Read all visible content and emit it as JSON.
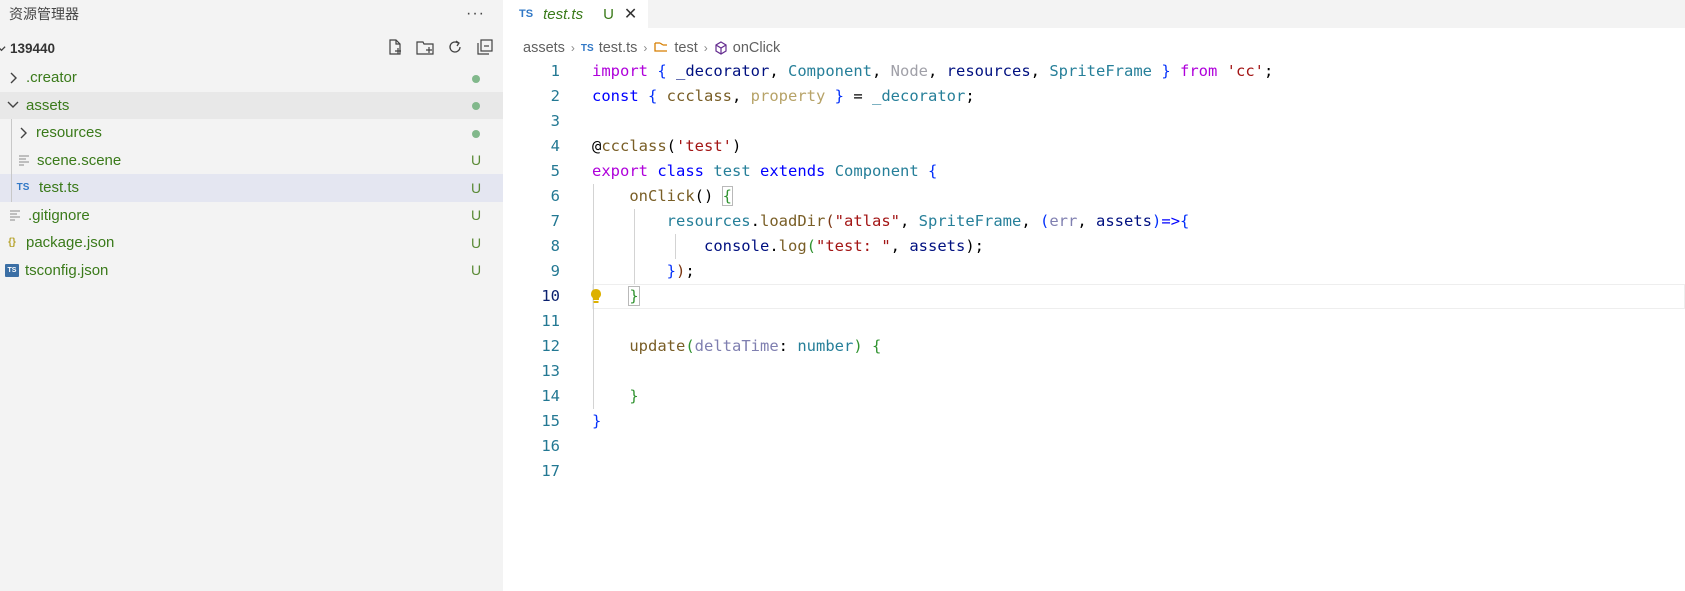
{
  "explorer": {
    "title": "资源管理器",
    "more": "···",
    "root": "139440",
    "items": [
      {
        "label": ".creator",
        "status": "dot",
        "kind": "folder"
      },
      {
        "label": "assets",
        "status": "dot",
        "kind": "folder-open"
      },
      {
        "label": "resources",
        "status": "dot",
        "kind": "folder"
      },
      {
        "label": "scene.scene",
        "status": "U",
        "kind": "file"
      },
      {
        "label": "test.ts",
        "status": "U",
        "kind": "ts",
        "icon_text": "TS"
      },
      {
        "label": ".gitignore",
        "status": "U",
        "kind": "file"
      },
      {
        "label": "package.json",
        "status": "U",
        "kind": "json",
        "icon_text": "{}"
      },
      {
        "label": "tsconfig.json",
        "status": "U",
        "kind": "tsconfig",
        "icon_text": "TS"
      }
    ]
  },
  "tab": {
    "icon_text": "TS",
    "name": "test.ts",
    "status": "U",
    "close": "✕"
  },
  "breadcrumb": [
    "assets",
    "test.ts",
    "test",
    "onClick"
  ],
  "breadcrumb_icon_ts": "TS",
  "line_numbers": [
    "1",
    "2",
    "3",
    "4",
    "5",
    "6",
    "7",
    "8",
    "9",
    "10",
    "11",
    "12",
    "13",
    "14",
    "15",
    "16",
    "17"
  ],
  "code": {
    "l1": [
      "import",
      " { ",
      "_decorator",
      ", ",
      "Component",
      ", ",
      "Node",
      ", ",
      "resources",
      ", ",
      "SpriteFrame",
      " } ",
      "from",
      " ",
      "'cc'",
      ";"
    ],
    "l2": [
      "const",
      " { ",
      "ccclass",
      ", ",
      "property",
      " } ",
      "= ",
      "_decorator",
      ";"
    ],
    "l4": [
      "@",
      "ccclass",
      "(",
      "'test'",
      ")"
    ],
    "l5": [
      "export",
      " ",
      "class",
      " ",
      "test",
      " ",
      "extends",
      " ",
      "Component",
      " ",
      "{"
    ],
    "l6": [
      "    ",
      "onClick",
      "() ",
      "{"
    ],
    "l7": [
      "        ",
      "resources",
      ".",
      "loadDir",
      "(",
      "\"atlas\"",
      ", ",
      "SpriteFrame",
      ", ",
      "(",
      "err",
      ", ",
      "assets",
      ")",
      "=>",
      "{"
    ],
    "l8": [
      "            ",
      "console",
      ".",
      "log",
      "(",
      "\"test: \"",
      ", ",
      "assets",
      ");"
    ],
    "l9": [
      "        ",
      "}",
      ")",
      ";"
    ],
    "l10": [
      "    ",
      "}"
    ],
    "l12": [
      "    ",
      "update",
      "(",
      "deltaTime",
      ": ",
      "number",
      ") ",
      "{"
    ],
    "l14": [
      "    ",
      "}"
    ],
    "l15": [
      "}"
    ]
  },
  "colors": {
    "accent": "#3178c6",
    "untracked": "#3a7a1a",
    "git_dot": "#81b88b"
  }
}
